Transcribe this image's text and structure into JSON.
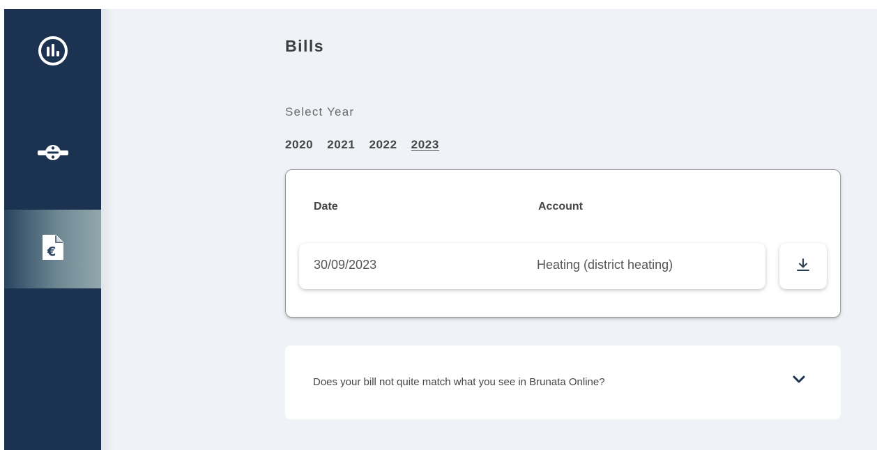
{
  "sidebar": {
    "items": [
      {
        "name": "overview",
        "icon": "bar-chart-circle-icon"
      },
      {
        "name": "meter",
        "icon": "meter-divide-icon"
      },
      {
        "name": "bills",
        "icon": "euro-document-icon",
        "active": true
      }
    ]
  },
  "page": {
    "title": "Bills",
    "select_year_label": "Select Year",
    "years": [
      "2020",
      "2021",
      "2022",
      "2023"
    ],
    "selected_year": "2023"
  },
  "table": {
    "headers": {
      "date": "Date",
      "account": "Account"
    },
    "rows": [
      {
        "date": "30/09/2023",
        "account": "Heating (district heating)",
        "action_icon": "download-icon"
      }
    ]
  },
  "faq": {
    "question": "Does your bill not quite match what you see in Brunata Online?",
    "icon": "chevron-down-icon"
  },
  "colors": {
    "sidebar_bg": "#1b3350",
    "main_bg": "#eff3f7",
    "text_dark": "#454545"
  }
}
